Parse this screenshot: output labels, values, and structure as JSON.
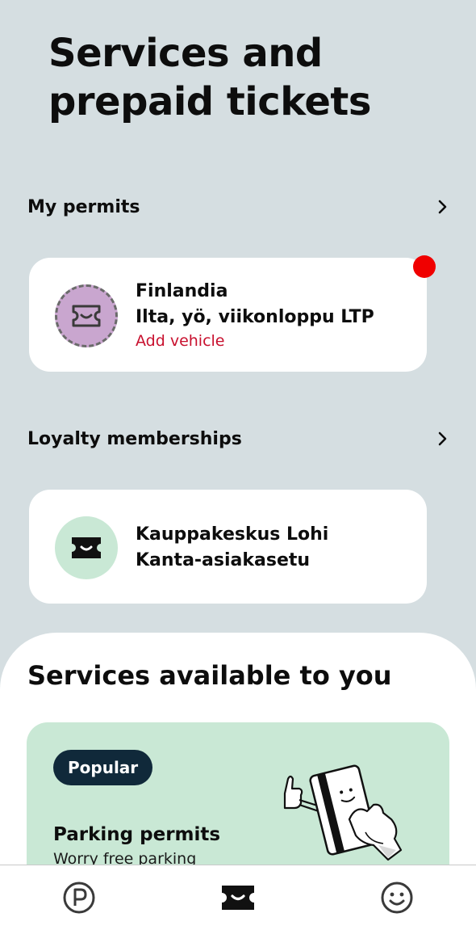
{
  "page": {
    "title": "Services and prepaid tickets"
  },
  "permits_section": {
    "header": "My permits",
    "chevron_icon": "chevron-right-icon",
    "card": {
      "icon": "ticket-icon",
      "line1": "Finlandia",
      "line2": "Ilta, yö, viikonloppu LTP",
      "action": "Add vehicle",
      "action_color": "#c8102e",
      "notification": true,
      "notification_color": "#f00000"
    }
  },
  "loyalty_section": {
    "header": "Loyalty memberships",
    "chevron_icon": "chevron-right-icon",
    "card": {
      "icon": "ticket-icon",
      "line1": "Kauppakeskus Lohi",
      "line2": "Kanta-asiakasetu"
    }
  },
  "services_sheet": {
    "title": "Services available to you",
    "promo": {
      "badge": "Popular",
      "title": "Parking permits",
      "subtitle": "Worry free parking",
      "illustration": "hand-holding-card-illustration",
      "background": "#c9e8d5"
    }
  },
  "bottom_nav": {
    "items": [
      {
        "icon": "parking-icon",
        "active": false
      },
      {
        "icon": "ticket-icon",
        "active": true
      },
      {
        "icon": "smiley-icon",
        "active": false
      }
    ]
  }
}
